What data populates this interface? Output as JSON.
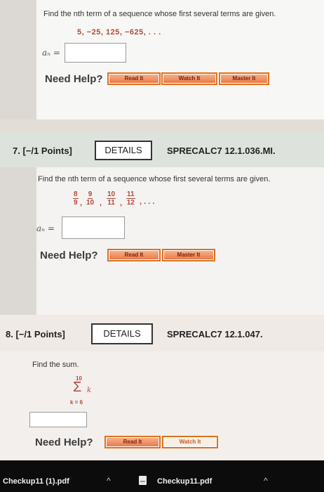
{
  "q6": {
    "prompt": "Find the nth term of a sequence whose first several terms are given.",
    "sequence": "5, −25, 125, −625, . . .",
    "an_label": "aₙ =",
    "need_help": "Need Help?",
    "buttons": [
      "Read It",
      "Watch It",
      "Master It"
    ]
  },
  "q7": {
    "number": "7. [−/1 Points]",
    "details": "DETAILS",
    "code": "SPRECALC7 12.1.036.MI.",
    "prompt": "Find the nth term of a sequence whose first several terms are given.",
    "fractions": [
      {
        "num": "8",
        "den": "9"
      },
      {
        "num": "9",
        "den": "10"
      },
      {
        "num": "10",
        "den": "11"
      },
      {
        "num": "11",
        "den": "12"
      }
    ],
    "ellipsis": ", . . .",
    "an_label": "aₙ =",
    "need_help": "Need Help?",
    "buttons": [
      "Read It",
      "Master It"
    ]
  },
  "q8": {
    "number": "8. [−/1 Points]",
    "details": "DETAILS",
    "code": "SPRECALC7 12.1.047.",
    "prompt": "Find the sum.",
    "sum_upper": "10",
    "sum_symbol": "Σ",
    "sum_term": "k",
    "sum_lower": "k = 6",
    "need_help": "Need Help?",
    "buttons": [
      "Read It",
      "Watch It"
    ]
  },
  "taskbar": {
    "file1": "Checkup11 (1).pdf",
    "file2": "Checkup11.pdf",
    "chevron": "^"
  },
  "icons": {
    "pdf": "pdf-file-icon",
    "chevron": "chevron-up-icon"
  },
  "colors": {
    "help_button_border": "#e0711e",
    "sequence_text": "#b24a3a",
    "taskbar": "#0c0c0c"
  }
}
